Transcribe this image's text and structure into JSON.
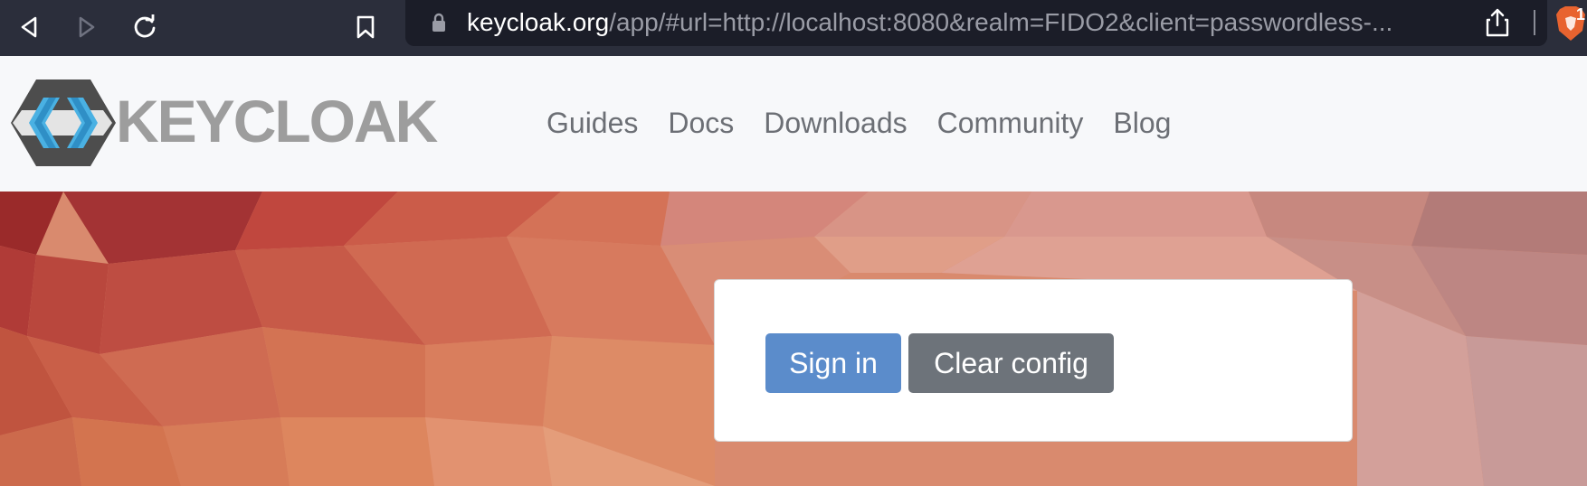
{
  "browser": {
    "url_host": "keycloak.org",
    "url_rest": "/app/#url=http://localhost:8080&realm=FIDO2&client=passwordless-...",
    "badge_count": "1",
    "icons": [
      "back-icon",
      "forward-icon",
      "reload-icon",
      "bookmark-icon",
      "lock-icon",
      "share-icon",
      "brave-shield-icon"
    ]
  },
  "site": {
    "logo_text": "KEYCLOAK",
    "nav": {
      "guides": "Guides",
      "docs": "Docs",
      "downloads": "Downloads",
      "community": "Community",
      "blog": "Blog"
    }
  },
  "card": {
    "sign_in_label": "Sign in",
    "clear_config_label": "Clear config"
  },
  "colors": {
    "primary": "#5b8ccb",
    "secondary": "#6d737a",
    "chrome": "#2b2e3b"
  }
}
